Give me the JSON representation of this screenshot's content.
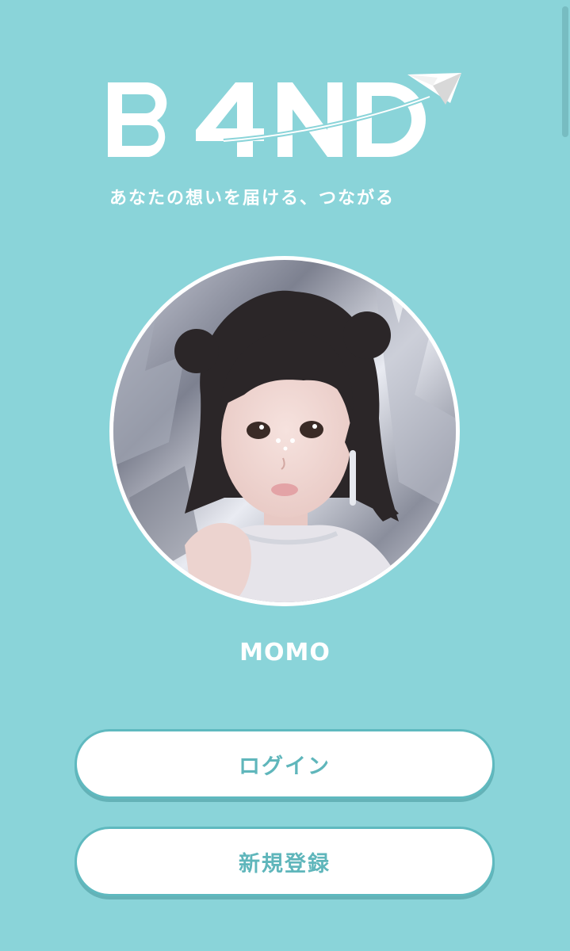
{
  "app": {
    "logo_text": "B4ND",
    "tagline": "あなたの想いを届ける、つながる"
  },
  "profile": {
    "name": "MOMO"
  },
  "actions": {
    "login_label": "ログイン",
    "register_label": "新規登録"
  },
  "colors": {
    "background": "#8ad4d9",
    "accent": "#5fb6bb",
    "button_bg": "#ffffff"
  },
  "icons": {
    "logo_mark": "paper-plane-icon"
  }
}
